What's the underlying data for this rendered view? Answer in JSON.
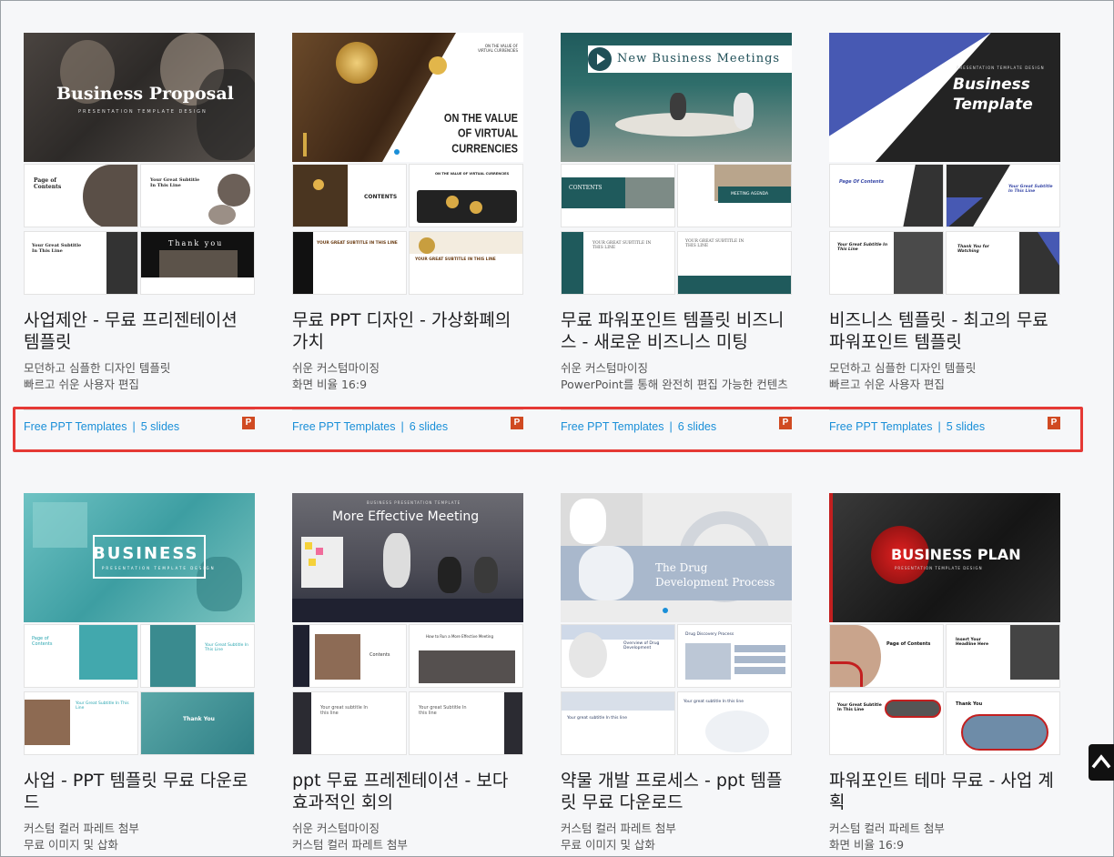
{
  "cards": [
    {
      "title": "사업제안 - 무료 프리젠테이션 템플릿",
      "desc1": "모던하고 심플한 디자인 템플릿",
      "desc2": "빠르고 쉬운 사용자 편집",
      "category": "Free PPT Templates",
      "slides": "5 slides",
      "badge": "P",
      "thumb": {
        "main_title": "Business Proposal",
        "main_sub": "PRESENTATION TEMPLATE DESIGN",
        "s1": "Page of Contents",
        "s2": "Your Great Subtitle In This Line",
        "s3": "Your Great Subtitle In This Line",
        "s4": "Thank you"
      }
    },
    {
      "title": "무료 PPT 디자인 - 가상화폐의 가치",
      "desc1": "쉬운 커스텀마이징",
      "desc2": "화면 비율 16:9",
      "category": "Free PPT Templates",
      "slides": "6 slides",
      "badge": "P",
      "thumb": {
        "main_title": "ON THE VALUE OF VIRTUAL CURRENCIES",
        "main_top": "ON THE VALUE OF VIRTUAL CURRENCIES",
        "s1": "CONTENTS",
        "s2": "ON THE VALUE OF VIRTUAL CURRENCIES",
        "s3": "YOUR GREAT SUBTITLE IN THIS LINE",
        "s4": "YOUR GREAT SUBTITLE IN THIS LINE"
      }
    },
    {
      "title": "무료 파워포인트 템플릿 비즈니스 - 새로운 비즈니스 미팅",
      "desc1": "쉬운 커스텀마이징",
      "desc2": "PowerPoint를 통해 완전히 편집 가능한 컨텐츠",
      "category": "Free PPT Templates",
      "slides": "6 slides",
      "badge": "P",
      "thumb": {
        "main_title": "New Business Meetings",
        "s1": "CONTENTS",
        "s2": "MEETING AGENDA",
        "s3": "YOUR GREAT SUBTITLE IN THIS LINE",
        "s4": "YOUR GREAT SUBTITLE IN THIS LINE"
      }
    },
    {
      "title": "비즈니스 템플릿 - 최고의 무료 파워포인트 템플릿",
      "desc1": "모던하고 심플한 디자인 템플릿",
      "desc2": "빠르고 쉬운 사용자 편집",
      "category": "Free PPT Templates",
      "slides": "5 slides",
      "badge": "P",
      "thumb": {
        "main_title": "Business Template",
        "main_sub": "PRESENTATION TEMPLATE DESIGN",
        "s1": "Page Of Contents",
        "s2": "Your Great Subtitle In This Line",
        "s3": "Your Great Subtitle In This Line",
        "s4": "Thank You for Watching"
      }
    },
    {
      "title": "사업 - PPT 템플릿 무료 다운로드",
      "desc1": "커스텀 컬러 파레트 첨부",
      "desc2": "무료 이미지 및 삽화",
      "thumb": {
        "main_title": "BUSINESS",
        "main_sub": "PRESENTATION TEMPLATE DESIGN",
        "s1": "Page of Contents",
        "s2": "Your Great Subtitle In This Line",
        "s3": "Your Great Subtitle In This Line",
        "s4": "Thank You"
      }
    },
    {
      "title": "ppt 무료 프레젠테이션 - 보다 효과적인 회의",
      "desc1": "쉬운 커스텀마이징",
      "desc2": "커스텀 컬러 파레트 첨부",
      "thumb": {
        "main_top": "BUSINESS PRESENTATION TEMPLATE",
        "main_title": "More Effective Meeting",
        "s1": "Contents",
        "s2": "How to Run a More Effective Meeting",
        "s3": "Your great subtitle In this line",
        "s4": "Your great Subtitle In this line"
      }
    },
    {
      "title": "약물 개발 프로세스 - ppt 템플릿 무료 다운로드",
      "desc1": "커스텀 컬러 파레트 첨부",
      "desc2": "무료 이미지 및 삽화",
      "thumb": {
        "main_title": "The Drug Development Process",
        "s1": "Overview of Drug Development",
        "s2": "Drug Discovery Process",
        "s3": "Your great subtitle In this line",
        "s4": "Your great subtitle In this line"
      }
    },
    {
      "title": "파워포인트 테마 무료 - 사업 계획",
      "desc1": "커스텀 컬러 파레트 첨부",
      "desc2": "화면 비율 16:9",
      "thumb": {
        "main_title": "BUSINESS PLAN",
        "main_sub": "PRESENTATION TEMPLATE DESIGN",
        "s1": "Page of Contents",
        "s2": "Insert Your Headline Here",
        "s3": "Your Great Subtitle In This Line",
        "s4": "Thank You"
      }
    }
  ]
}
